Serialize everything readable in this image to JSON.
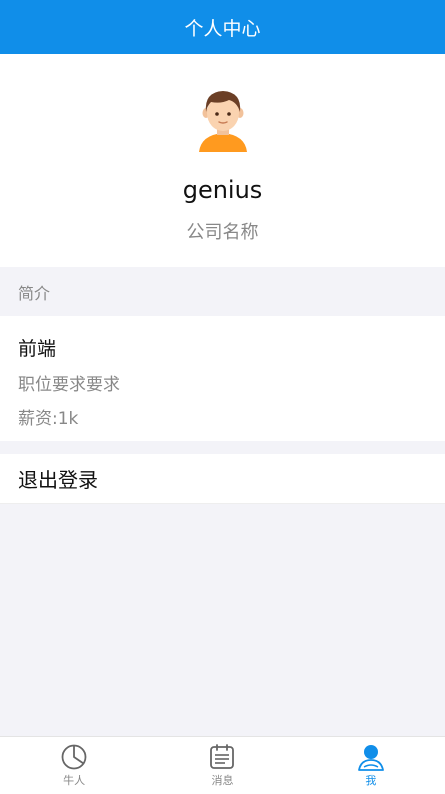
{
  "header": {
    "title": "个人中心"
  },
  "profile": {
    "username": "genius",
    "company": "公司名称"
  },
  "section": {
    "intro_label": "简介"
  },
  "job": {
    "title": "前端",
    "description": "职位要求要求",
    "salary": "薪资:1k"
  },
  "actions": {
    "logout_label": "退出登录"
  },
  "tabbar": {
    "tabs": [
      {
        "label": "牛人",
        "icon": "pie-chart-icon",
        "active": false
      },
      {
        "label": "消息",
        "icon": "calendar-icon",
        "active": false
      },
      {
        "label": "我",
        "icon": "user-icon",
        "active": true
      }
    ]
  },
  "colors": {
    "primary": "#108ee9",
    "inactive": "#888888"
  }
}
